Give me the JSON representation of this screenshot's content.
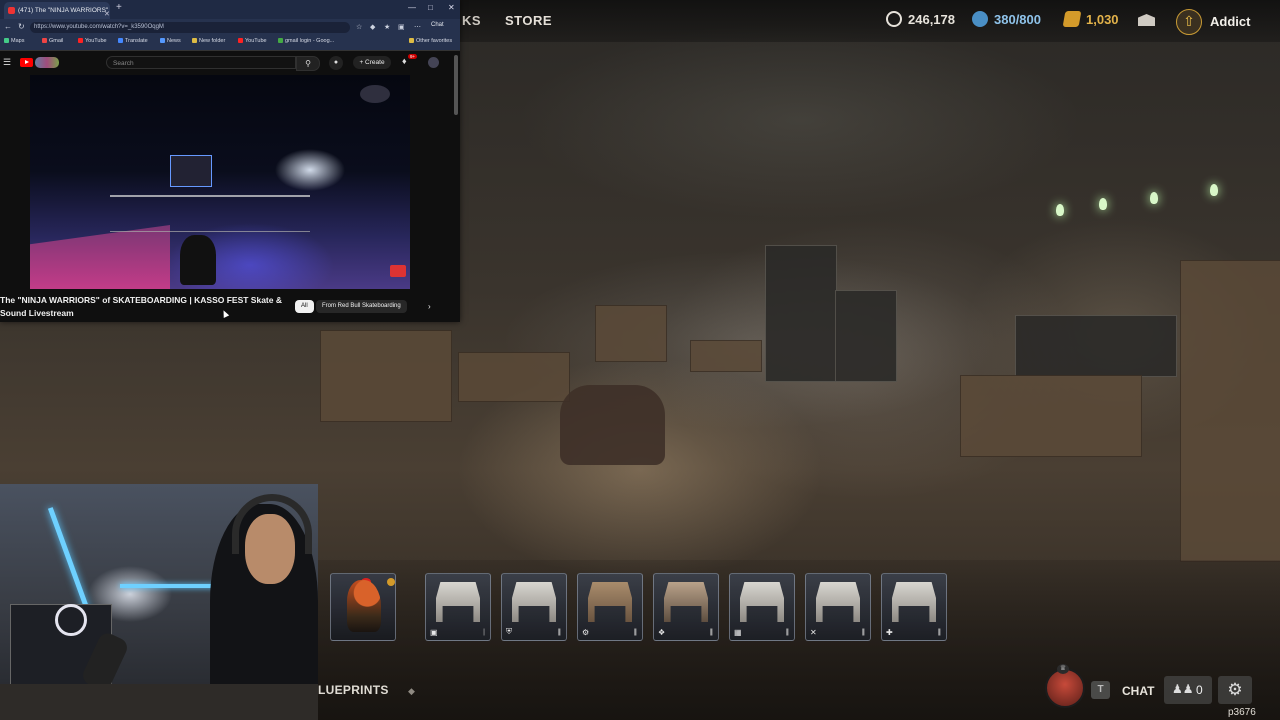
{
  "game": {
    "nav_partial": "KS",
    "nav_store": "STORE",
    "currency": [
      {
        "name": "credits",
        "value": "246,178",
        "color": "#e6e2da"
      },
      {
        "name": "silver",
        "value": "380/800",
        "color": "#4a8fc5"
      },
      {
        "name": "gold",
        "value": "1,030",
        "color": "#d39a2a"
      }
    ],
    "rank_label": "Addict",
    "blueprints_label": "LUEPRINTS",
    "chat_key": "T",
    "chat_label": "CHAT",
    "friends_count": "0",
    "player_id": "p3676",
    "item_slots": [
      {
        "name": "rooster-slot",
        "icon": "rooster"
      },
      {
        "name": "bench-slot-1",
        "icon": "tag-icon"
      },
      {
        "name": "bench-slot-2",
        "icon": "shield-icon"
      },
      {
        "name": "bench-slot-3",
        "icon": "gear-icon"
      },
      {
        "name": "bench-slot-4",
        "icon": "cursor-icon"
      },
      {
        "name": "bench-slot-5",
        "icon": "grid-icon"
      },
      {
        "name": "bench-slot-6",
        "icon": "x-icon"
      },
      {
        "name": "bench-slot-7",
        "icon": "plus-icon"
      }
    ]
  },
  "browser": {
    "tab_title": "(471) The \"NINJA WARRIORS\"",
    "url": "https://www.youtube.com/watch?v=_k3590OqgM",
    "chat_label": "Chat",
    "bookmarks": [
      "Maps",
      "Gmail",
      "YouTube",
      "Translate",
      "News",
      "New folder",
      "YouTube",
      "gmail login - Goog...",
      "Other favorites"
    ],
    "search_placeholder": "Search",
    "create_label": "Create",
    "notifications_badge": "9+",
    "video_title": "The \"NINJA WARRIORS\" of SKATEBOARDING | KASSO FEST Skate & Sound Livestream",
    "chips": [
      "All",
      "From Red Bull Skateboarding"
    ]
  }
}
